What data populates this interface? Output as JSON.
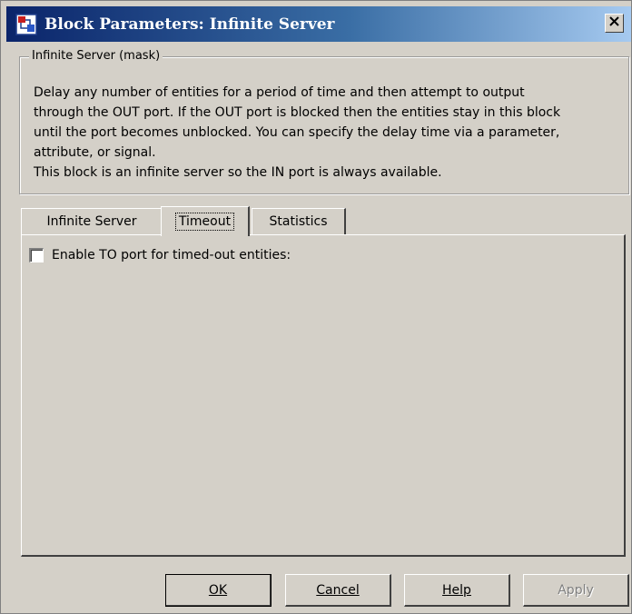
{
  "window": {
    "title": "Block Parameters: Infinite Server"
  },
  "group": {
    "legend": "Infinite Server (mask)",
    "description": "Delay any number of entities for a period of time and then attempt to output\nthrough the OUT port. If the OUT port is blocked then the entities stay in this block\nuntil the port becomes unblocked. You can specify the delay time via a parameter,\nattribute, or signal.\nThis block is an infinite server so the IN port is always available."
  },
  "tabs": [
    {
      "label": "Infinite Server",
      "active": false
    },
    {
      "label": "Timeout",
      "active": true
    },
    {
      "label": "Statistics",
      "active": false
    }
  ],
  "panel": {
    "enable_to_port_label": "Enable TO port for timed-out entities:",
    "enable_to_port_checked": false
  },
  "buttons": {
    "ok_label": "OK",
    "cancel_label": "Cancel",
    "help_label": "Help",
    "apply_label": "Apply",
    "apply_enabled": false
  },
  "icons": {
    "app": "simulink-block-icon",
    "close": "close-icon"
  },
  "colors": {
    "title_gradient_start": "#0a246a",
    "title_gradient_end": "#a6caf0",
    "face": "#d4d0c8"
  }
}
